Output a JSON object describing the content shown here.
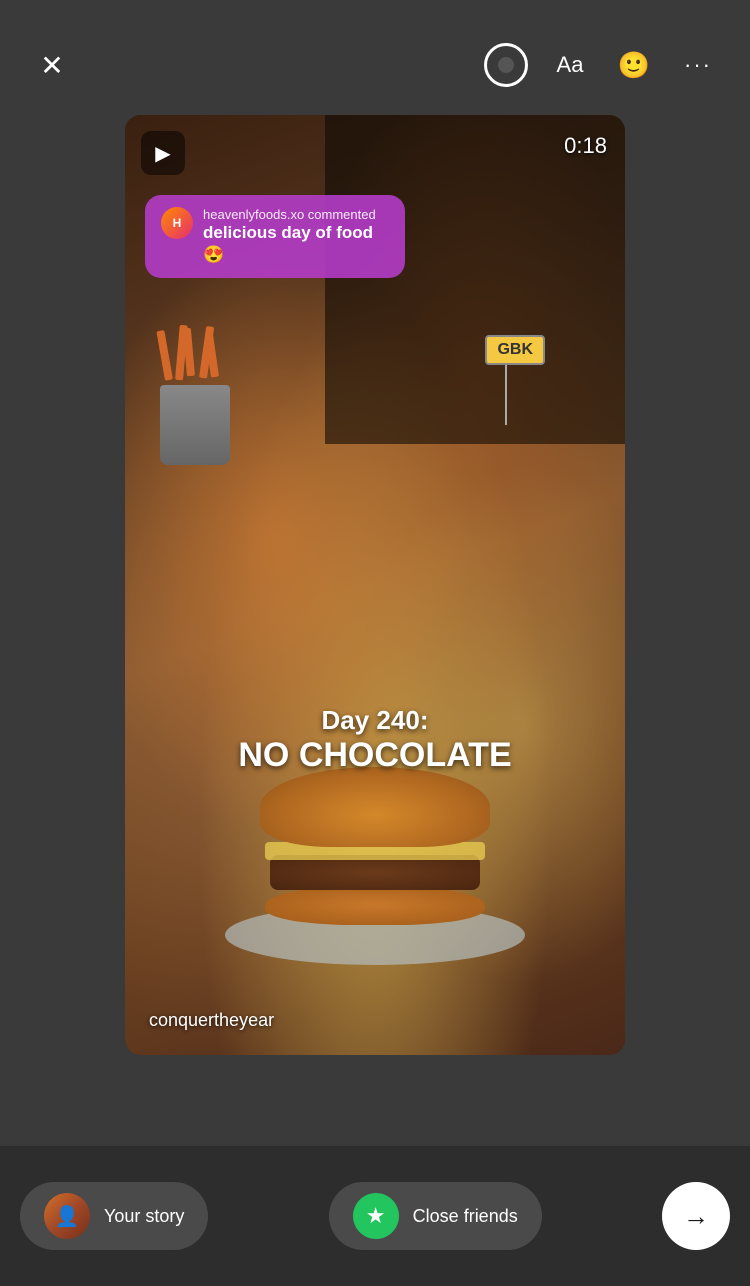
{
  "toolbar": {
    "close_label": "✕",
    "text_label": "Aa",
    "dots_label": "···"
  },
  "story": {
    "timer": "0:18",
    "icon_emoji": "▶",
    "comment": {
      "username": "heavenlyfoods.xo commented",
      "text": "delicious day of food 😍",
      "emoji": "😍"
    },
    "overlay_line1": "Day 240:",
    "overlay_line2": "NO CHOCOLATE",
    "author": "conquertheyear",
    "gbk_label": "GBK"
  },
  "bottom_bar": {
    "your_story_label": "Your story",
    "close_friends_label": "Close friends",
    "next_label": "→"
  }
}
